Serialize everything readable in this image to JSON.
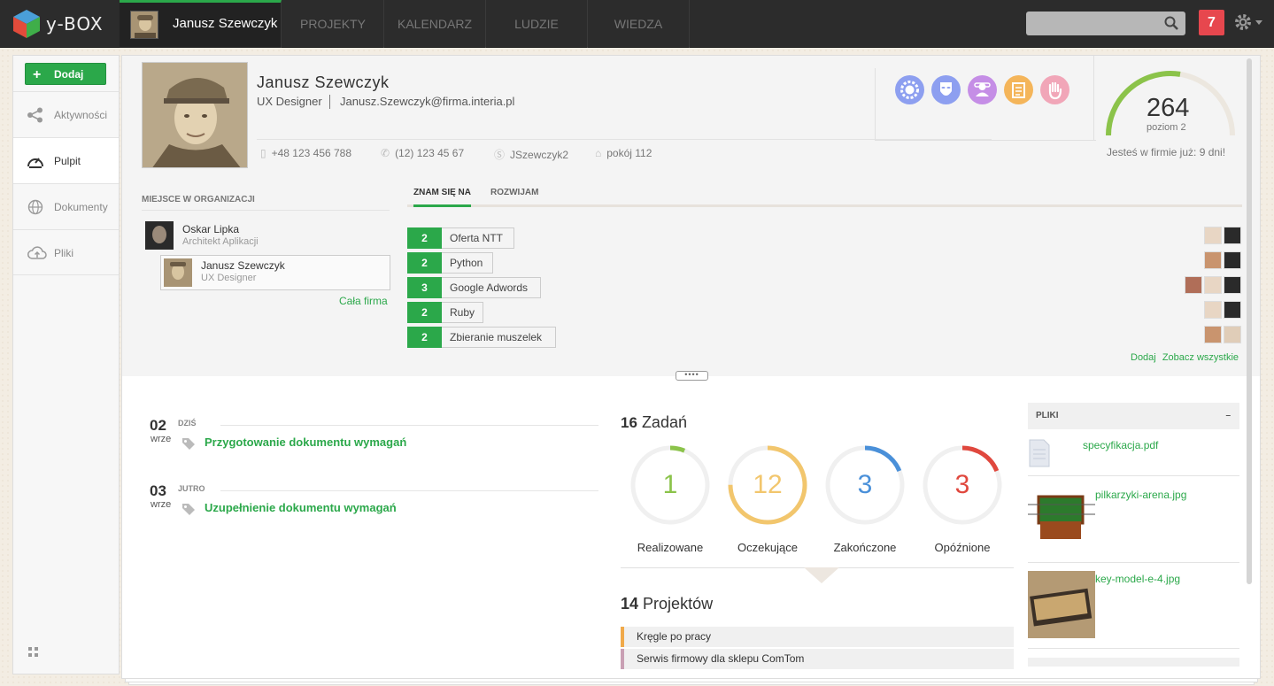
{
  "app": {
    "logo_text": "y-BOX"
  },
  "nav": {
    "user_name": "Janusz Szewczyk",
    "items": [
      "PROJEKTY",
      "KALENDARZ",
      "LUDZIE",
      "WIEDZA"
    ],
    "notifications": "7",
    "search_placeholder": ""
  },
  "sidebar": {
    "add_label": "Dodaj",
    "items": [
      {
        "label": "Aktywności",
        "icon": "share-icon"
      },
      {
        "label": "Pulpit",
        "icon": "dashboard-icon"
      },
      {
        "label": "Dokumenty",
        "icon": "globe-icon"
      },
      {
        "label": "Pliki",
        "icon": "cloud-upload-icon"
      }
    ]
  },
  "profile": {
    "name": "Janusz Szewczyk",
    "role": "UX Designer",
    "email": "Janusz.Szewczyk@firma.interia.pl",
    "mobile": "+48 123 456 788",
    "phone": "(12) 123 45 67",
    "skype": "JSzewczyk2",
    "room": "pokój 112",
    "badges": [
      {
        "icon": "cog-badge-icon",
        "color": "#8d9ff0"
      },
      {
        "icon": "mask-badge-icon",
        "color": "#8d9ff0"
      },
      {
        "icon": "users-badge-icon",
        "color": "#c58ee6"
      },
      {
        "icon": "clipboard-badge-icon",
        "color": "#f4b55a"
      },
      {
        "icon": "hand-badge-icon",
        "color": "#f1a6b8"
      }
    ],
    "score": "264",
    "level": "poziom 2",
    "level_progress": 0.55,
    "tenure": "Jesteś w firmie już: 9 dni!"
  },
  "org": {
    "title": "MIEJSCE W ORGANIZACJI",
    "superior": {
      "name": "Oskar Lipka",
      "role": "Architekt Aplikacji"
    },
    "me": {
      "name": "Janusz Szewczyk",
      "role": "UX Designer"
    },
    "all_link": "Cała firma"
  },
  "skills": {
    "tabs": [
      "ZNAM SIĘ NA",
      "ROZWIJAM"
    ],
    "items": [
      {
        "count": "2",
        "name": "Oferta NTT",
        "faces": 2
      },
      {
        "count": "2",
        "name": "Python",
        "faces": 2
      },
      {
        "count": "3",
        "name": "Google Adwords",
        "faces": 3
      },
      {
        "count": "2",
        "name": "Ruby",
        "faces": 2
      },
      {
        "count": "2",
        "name": "Zbieranie muszelek",
        "faces": 2
      }
    ],
    "add_link": "Dodaj",
    "all_link": "Zobacz wszystkie"
  },
  "events": [
    {
      "day": "02",
      "label": "DZIŚ",
      "month": "wrze",
      "title": "Przygotowanie dokumentu wymagań"
    },
    {
      "day": "03",
      "label": "JUTRO",
      "month": "wrze",
      "title": "Uzupełnienie dokumentu wymagań"
    }
  ],
  "tasks": {
    "count": "16",
    "label": "Zadań",
    "rings": [
      {
        "value": "1",
        "label": "Realizowane",
        "color": "#8bc34a",
        "fraction": 0.0625
      },
      {
        "value": "12",
        "label": "Oczekujące",
        "color": "#f2c66d",
        "fraction": 0.75
      },
      {
        "value": "3",
        "label": "Zakończone",
        "color": "#4a90d9",
        "fraction": 0.1875
      },
      {
        "value": "3",
        "label": "Opóźnione",
        "color": "#e0483e",
        "fraction": 0.1875
      }
    ]
  },
  "projects": {
    "count": "14",
    "label": "Projektów",
    "items": [
      {
        "name": "Kręgle po pracy",
        "color": "#f0a94a"
      },
      {
        "name": "Serwis firmowy dla sklepu ComTom",
        "color": "#c9a0b4"
      }
    ]
  },
  "files": {
    "title": "PLIKI",
    "collapse": "–",
    "items": [
      {
        "name": "specyfikacja.pdf"
      },
      {
        "name": "pilkarzyki-arena.jpg"
      },
      {
        "name": "key-model-e-4.jpg"
      }
    ]
  }
}
